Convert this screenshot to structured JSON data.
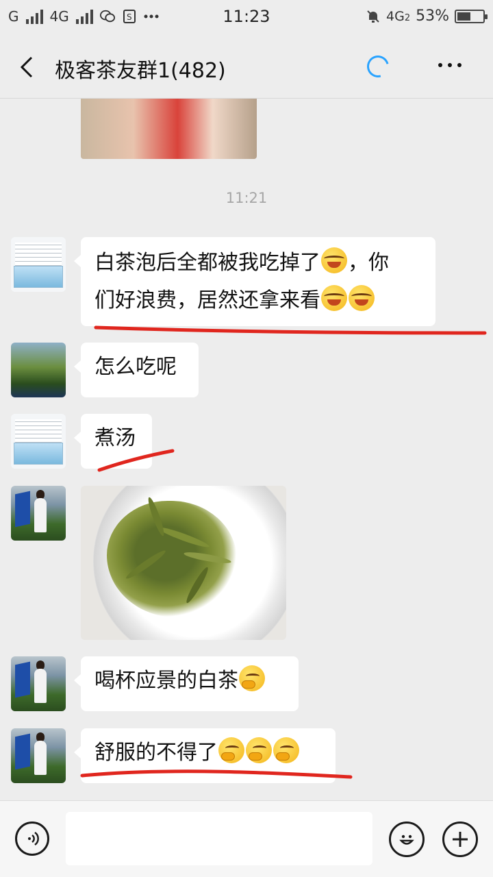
{
  "status_bar": {
    "carrier_1": "G",
    "carrier_2": "4G",
    "time": "11:23",
    "network": "4G",
    "network_sub": "2",
    "battery": "53%",
    "battery_level": 0.53
  },
  "header": {
    "title": "极客茶友群1(482)"
  },
  "chat": {
    "timestamp": "11:21",
    "messages": [
      {
        "line1": "白茶泡后全都被我吃掉了",
        "line1_after": "，你",
        "line2": "们好浪费，居然还拿来看"
      },
      {
        "text": "怎么吃呢"
      },
      {
        "text": "煮汤"
      },
      {
        "text": "喝杯应景的白茶"
      },
      {
        "text": "舒服的不得了"
      }
    ]
  },
  "colors": {
    "accent": "#29a3ff",
    "annotation": "#e0261e",
    "background": "#ededed",
    "bubble": "#ffffff"
  },
  "icons": {
    "back": "chevron-left-icon",
    "loading": "loading-spinner-icon",
    "more": "more-dots-icon",
    "voice": "voice-icon",
    "emoji": "emoji-icon",
    "add": "plus-icon"
  }
}
